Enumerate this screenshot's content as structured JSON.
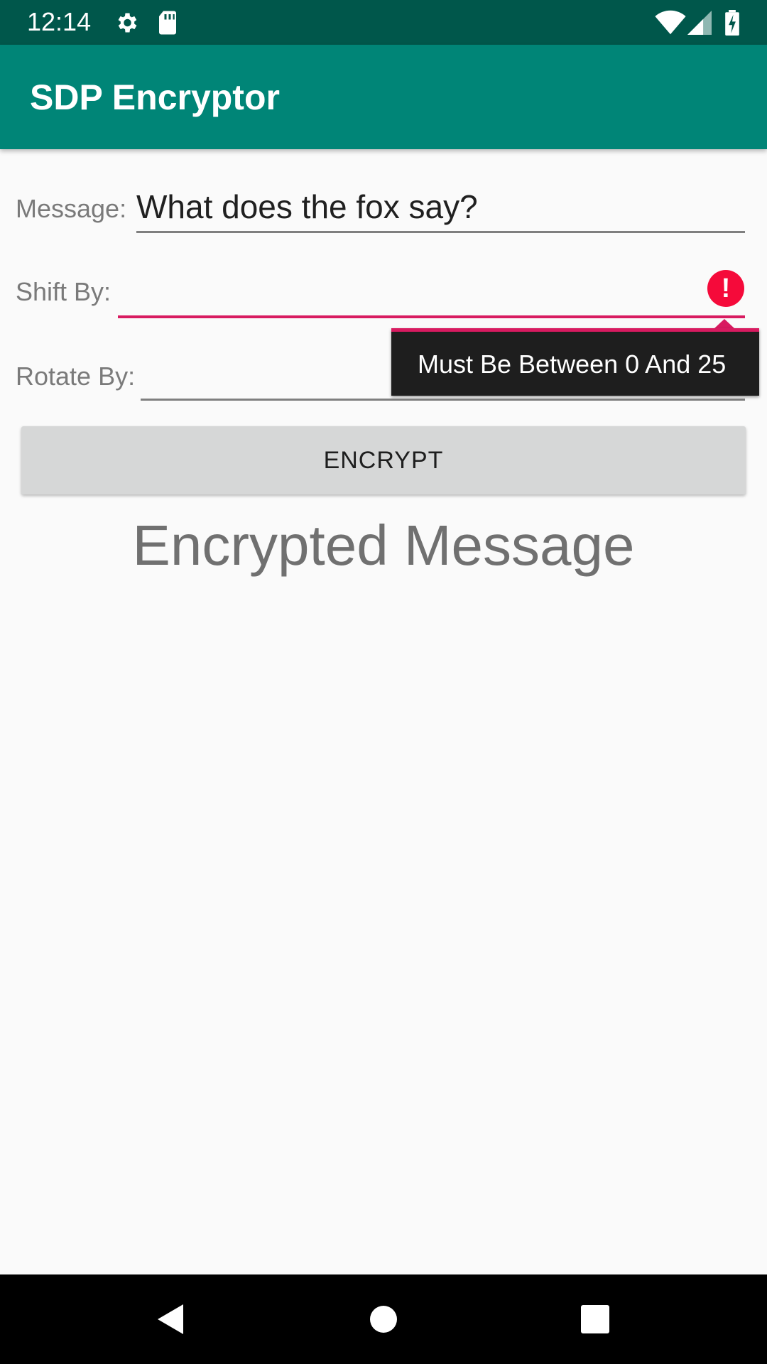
{
  "status_bar": {
    "time": "12:14",
    "icons": [
      "settings-gear-icon",
      "sd-card-icon",
      "wifi-icon",
      "cell-signal-icon",
      "battery-charging-icon"
    ]
  },
  "app_bar": {
    "title": "SDP Encryptor"
  },
  "form": {
    "message": {
      "label": "Message:",
      "value": "What does the fox say?"
    },
    "shift_by": {
      "label": "Shift By:",
      "value": "",
      "has_error": true
    },
    "rotate_by": {
      "label": "Rotate By:",
      "value": ""
    }
  },
  "error_popup": {
    "text": "Must Be Between 0 And 25"
  },
  "encrypt_button": {
    "label": "ENCRYPT"
  },
  "output": {
    "text": "Encrypted Message"
  },
  "nav_bar": {
    "buttons": [
      "back-icon",
      "home-icon",
      "recents-icon"
    ]
  },
  "colors": {
    "status_bar": "#00574b",
    "app_bar": "#008577",
    "error_accent": "#d81b60",
    "error_icon": "#f50a3a",
    "button": "#d6d7d7",
    "background": "#fafafa"
  }
}
